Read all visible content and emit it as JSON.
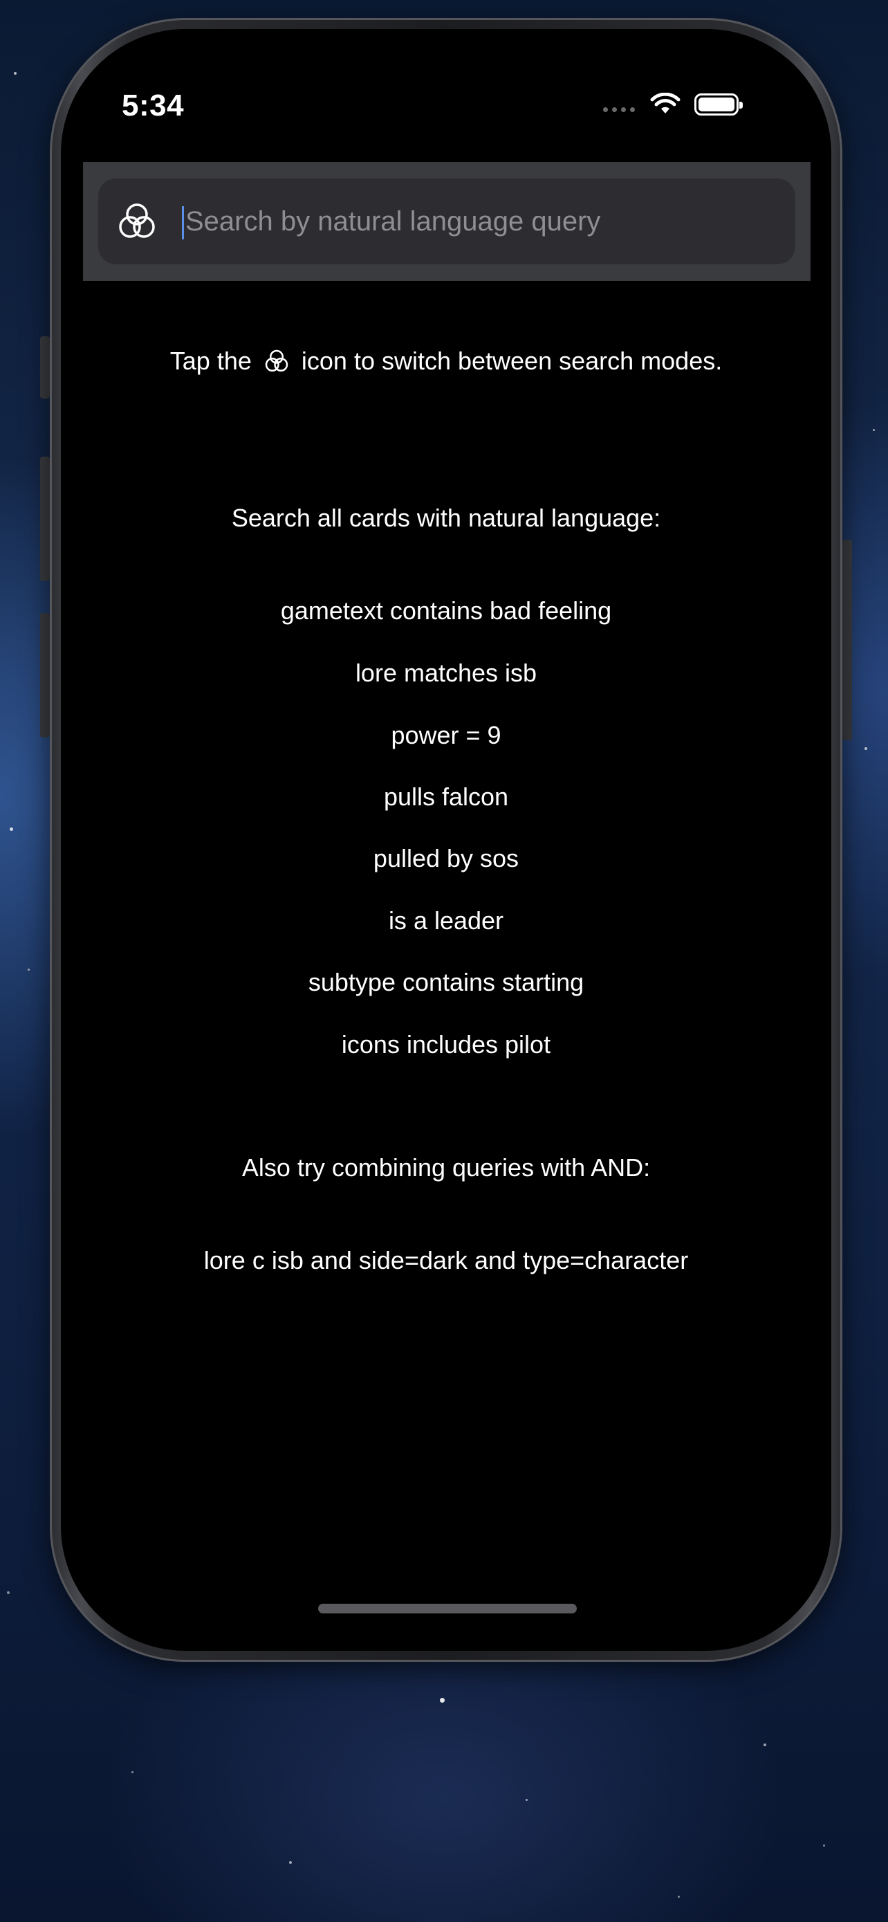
{
  "status_bar": {
    "time": "5:34"
  },
  "search": {
    "placeholder": "Search by natural language query",
    "mode_icon": "venn-diagram-icon"
  },
  "help": {
    "prefix": "Tap the",
    "suffix": "icon to switch between search modes.",
    "inline_icon": "venn-diagram-icon"
  },
  "natural_language": {
    "heading": "Search all cards with natural language:",
    "examples": [
      "gametext contains bad feeling",
      "lore matches isb",
      "power = 9",
      "pulls falcon",
      "pulled by sos",
      "is a leader",
      "subtype contains starting",
      "icons includes pilot"
    ]
  },
  "combining": {
    "heading": "Also try combining queries with AND:",
    "example": "lore c isb and side=dark and type=character"
  },
  "colors": {
    "screen_background": "#000000",
    "search_container": "#3a3b3f",
    "search_field": "#2c2c31",
    "placeholder": "#8e8e93",
    "cursor": "#5b8fe8",
    "text": "#ffffff"
  }
}
